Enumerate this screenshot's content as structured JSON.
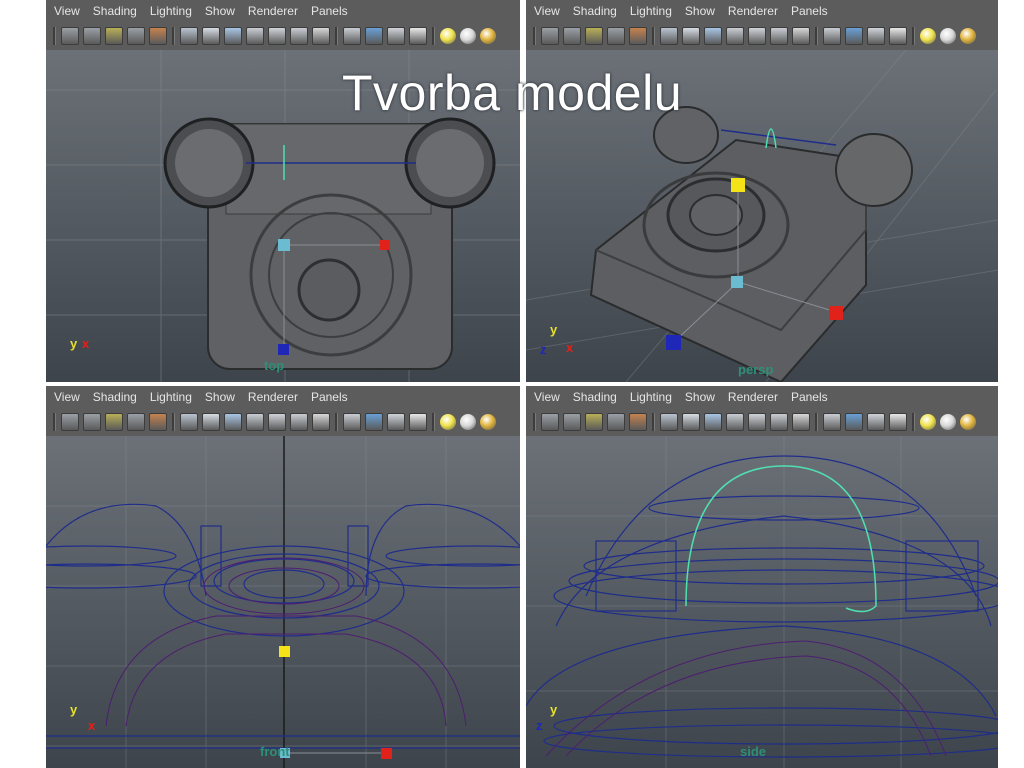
{
  "slide": {
    "title": "Tvorba modelu"
  },
  "viewport_menu": [
    "View",
    "Shading",
    "Lighting",
    "Show",
    "Renderer",
    "Panels"
  ],
  "toolbar_icons": [
    "camera-attributes-icon",
    "bookmark-icon",
    "image-plane-icon",
    "grease-pencil-icon",
    "isolate-select-icon",
    "wireframe-icon",
    "smooth-shade-icon",
    "flat-shade-icon",
    "bounding-box-icon",
    "points-icon",
    "texture-icon",
    "text-icon",
    "xray-icon",
    "shaded-cube-icon",
    "wire-on-shaded-icon",
    "checker-icon",
    "default-light-icon",
    "all-lights-icon",
    "shadow-icon"
  ],
  "viewports": [
    {
      "id": "top",
      "camera_label": "top"
    },
    {
      "id": "persp",
      "camera_label": "persp"
    },
    {
      "id": "front",
      "camera_label": "front"
    },
    {
      "id": "side",
      "camera_label": "side"
    }
  ],
  "axis": {
    "x": "x",
    "y": "y",
    "z": "z"
  },
  "colors": {
    "menubar": "#5c5c5c",
    "viewport_bg_top": "#6c7178",
    "viewport_bg_bottom": "#3d444b",
    "wire_blue": "#1f2d8a",
    "wire_purple": "#4d1e70",
    "curve_cyan": "#4fe0b0",
    "manip_red": "#e0221b",
    "manip_blue": "#1f27b8",
    "manip_yellow": "#f4e317",
    "manip_cyan": "#6bbcd0"
  }
}
